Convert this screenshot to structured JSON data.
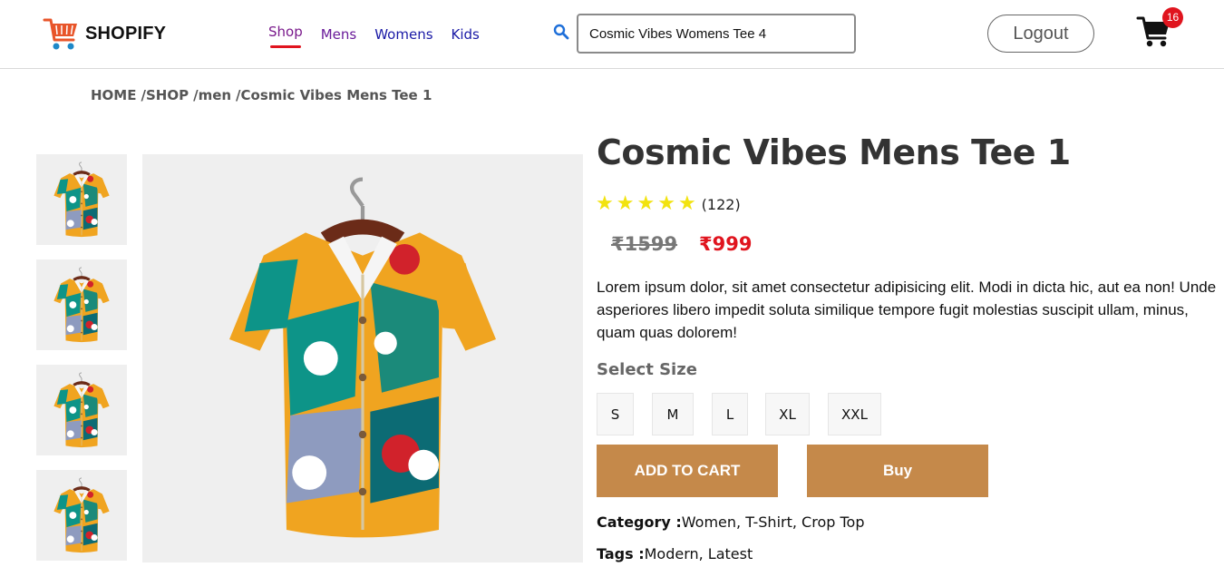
{
  "header": {
    "brand_name": "SHOPIFY",
    "nav": [
      {
        "label": "Shop",
        "active": true
      },
      {
        "label": "Mens",
        "active": false
      },
      {
        "label": "Womens",
        "active": false
      },
      {
        "label": "Kids",
        "active": false
      }
    ],
    "search_value": "Cosmic Vibes Womens Tee 4",
    "logout_label": "Logout",
    "cart_count": "16"
  },
  "breadcrumb": [
    "HOME",
    "SHOP",
    "men",
    "Cosmic Vibes Mens Tee 1"
  ],
  "breadcrumb_separator": "/",
  "product": {
    "title": "Cosmic Vibes Mens Tee 1",
    "rating_stars": 5,
    "review_count": "(122)",
    "price_original": "₹1599",
    "price_sale": "₹999",
    "description": "Lorem ipsum dolor, sit amet consectetur adipisicing elit. Modi in dicta hic, aut ea non! Unde asperiores libero impedit soluta similique tempore fugit molestias suscipit ullam, minus, quam quas dolorem!",
    "size_heading": "Select Size",
    "sizes": [
      "S",
      "M",
      "L",
      "XL",
      "XXL"
    ],
    "add_to_cart_label": "ADD TO CART",
    "buy_label": "Buy",
    "category_label": "Category :",
    "category_value": "Women, T-Shirt, Crop Top",
    "tags_label": "Tags :",
    "tags_value": "Modern, Latest"
  },
  "colors": {
    "accent_button": "#c5894a",
    "sale_price": "#e0141e",
    "star": "#f2e30f",
    "badge": "#e0141e",
    "image_background": "#efefef"
  },
  "icons": {
    "logo": "shopping-cart-logo-icon",
    "search": "search-icon",
    "cart": "cart-icon",
    "star": "star-icon"
  }
}
